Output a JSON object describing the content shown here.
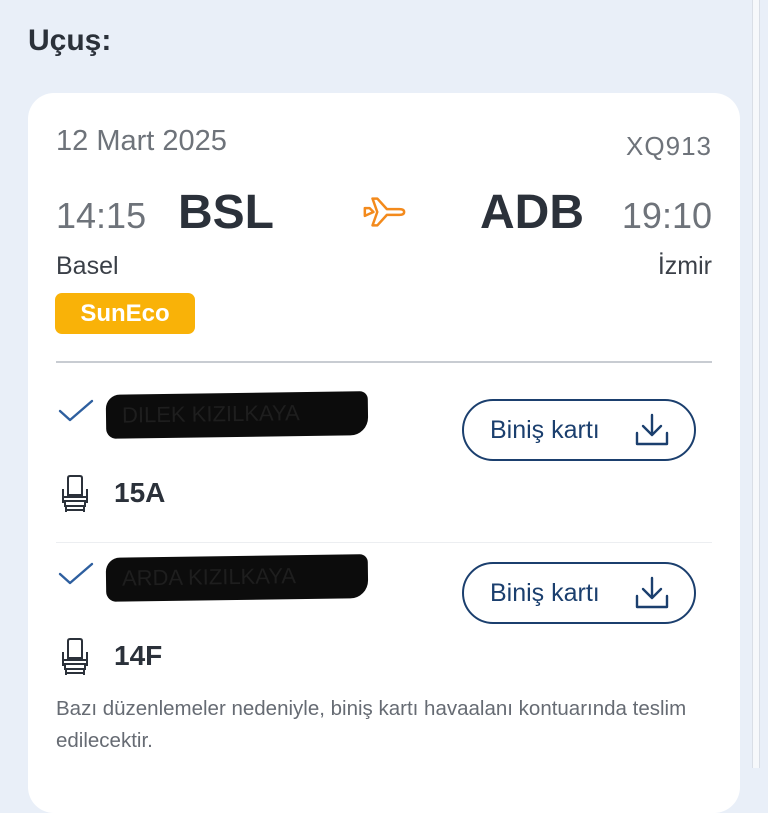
{
  "section": {
    "title": "Uçuş:"
  },
  "flight": {
    "date": "12 Mart 2025",
    "flight_number": "XQ913",
    "departure": {
      "time": "14:15",
      "code": "BSL",
      "city": "Basel"
    },
    "arrival": {
      "time": "19:10",
      "code": "ADB",
      "city": "İzmir"
    },
    "fare": "SunEco",
    "plane_icon": "airplane-icon"
  },
  "passengers": [
    {
      "name": "DILEK KIZILKAYA",
      "seat": "15A",
      "button_label": "Biniş kartı",
      "status_icon": "checkmark-icon",
      "seat_icon": "seat-icon",
      "download_icon": "download-icon"
    },
    {
      "name": "ARDA KIZILKAYA",
      "seat": "14F",
      "button_label": "Biniş kartı",
      "status_icon": "checkmark-icon",
      "seat_icon": "seat-icon",
      "download_icon": "download-icon"
    }
  ],
  "notice": "Bazı düzenlemeler nedeniyle, biniş kartı havaalanı kontuarında teslim edilecektir.",
  "colors": {
    "brand_blue": "#1b3f6e",
    "accent_orange": "#f38a1c",
    "fare_badge": "#f9b208",
    "check_blue": "#2e5f9f"
  }
}
